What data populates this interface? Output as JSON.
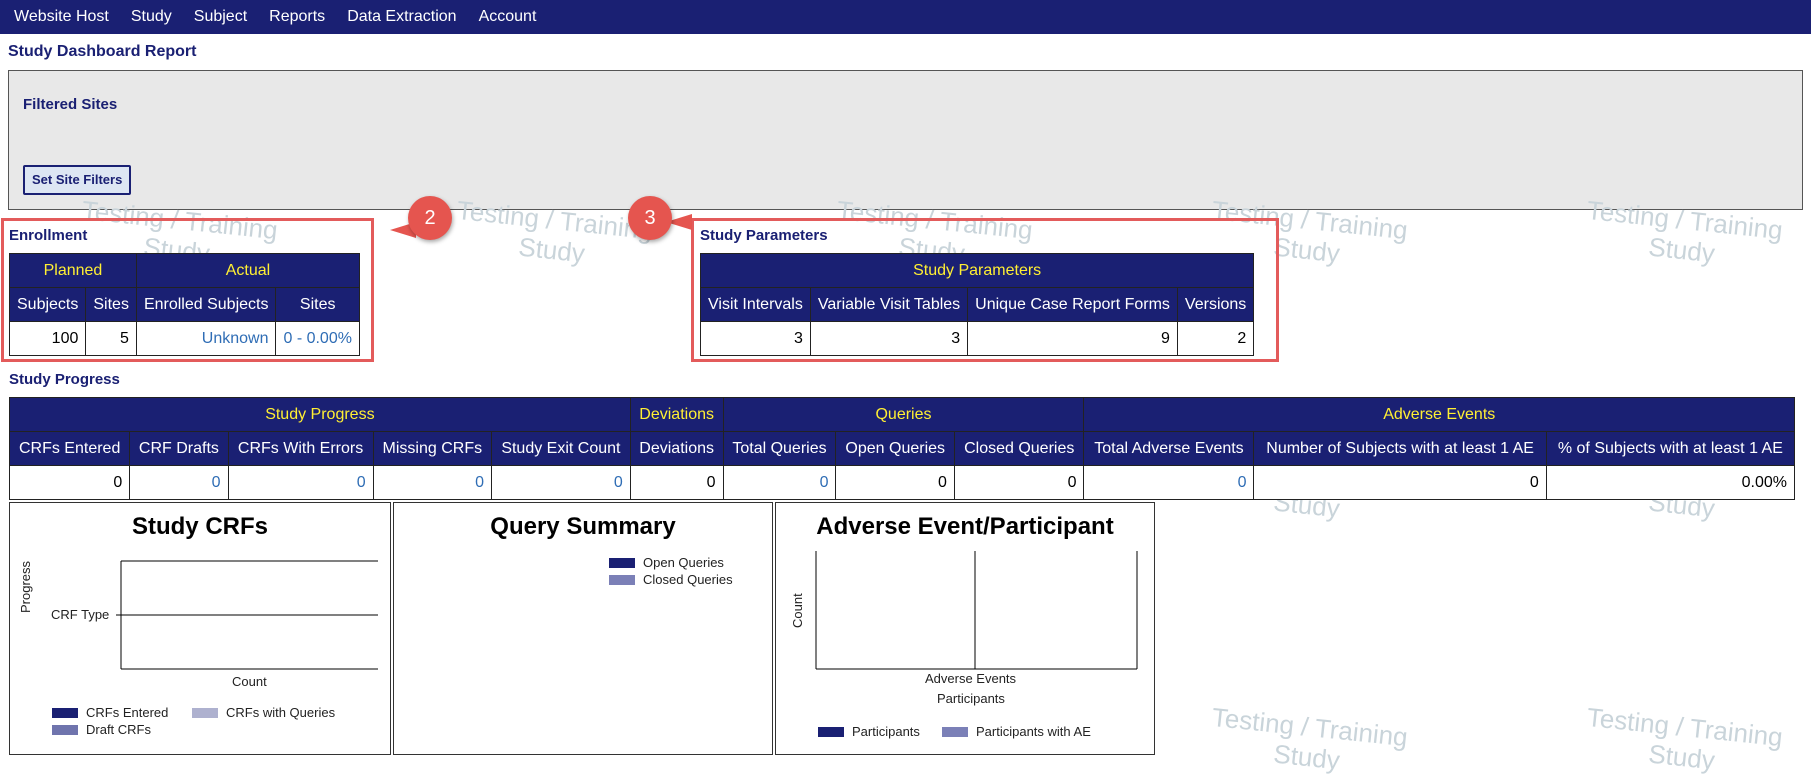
{
  "nav": {
    "items": [
      "Website Host",
      "Study",
      "Subject",
      "Reports",
      "Data Extraction",
      "Account"
    ]
  },
  "page_title": "Study Dashboard Report",
  "filters": {
    "title": "Filtered Sites",
    "button": "Set Site Filters"
  },
  "watermark": {
    "line1": "Testing / Training",
    "line2": "Study"
  },
  "callouts": {
    "enrollment": "2",
    "study_parameters": "3"
  },
  "enrollment": {
    "label": "Enrollment",
    "groups": [
      "Planned",
      "Actual"
    ],
    "headers": [
      "Subjects",
      "Sites",
      "Enrolled Subjects",
      "Sites"
    ],
    "values": [
      "100",
      "5",
      "Unknown",
      "0 - 0.00%"
    ]
  },
  "study_parameters": {
    "label": "Study Parameters",
    "group": "Study Parameters",
    "headers": [
      "Visit Intervals",
      "Variable Visit Tables",
      "Unique Case Report Forms",
      "Versions"
    ],
    "values": [
      "3",
      "3",
      "9",
      "2"
    ]
  },
  "study_progress": {
    "label": "Study Progress",
    "groups": [
      "Study Progress",
      "Deviations",
      "Queries",
      "Adverse Events"
    ],
    "headers": [
      "CRFs Entered",
      "CRF Drafts",
      "CRFs With Errors",
      "Missing CRFs",
      "Study Exit Count",
      "Deviations",
      "Total Queries",
      "Open Queries",
      "Closed Queries",
      "Total Adverse Events",
      "Number of Subjects with at least 1 AE",
      "% of Subjects with at least 1 AE"
    ],
    "values": [
      "0",
      "0",
      "0",
      "0",
      "0",
      "0",
      "0",
      "0",
      "0",
      "0",
      "0",
      "0.00%"
    ]
  },
  "charts": {
    "study_crfs": {
      "title": "Study CRFs",
      "ylabel": "Progress",
      "ytick": "CRF Type",
      "xlabel": "Count",
      "legend": [
        "CRFs Entered",
        "CRFs with Queries",
        "Draft CRFs"
      ],
      "colors": {
        "entered": "#1a2073",
        "queries": "#aeb1cf",
        "draft": "#6f74ad"
      }
    },
    "query_summary": {
      "title": "Query Summary",
      "legend": [
        "Open Queries",
        "Closed Queries"
      ],
      "colors": {
        "open": "#1a2073",
        "closed": "#7b80b7"
      }
    },
    "adverse_event": {
      "title": "Adverse Event/Participant",
      "ylabel": "Count",
      "xlabel1": "Adverse Events",
      "xlabel2": "Participants",
      "legend": [
        "Participants",
        "Participants with AE"
      ],
      "colors": {
        "participants": "#1a2073",
        "with_ae": "#7b80b7"
      }
    }
  }
}
